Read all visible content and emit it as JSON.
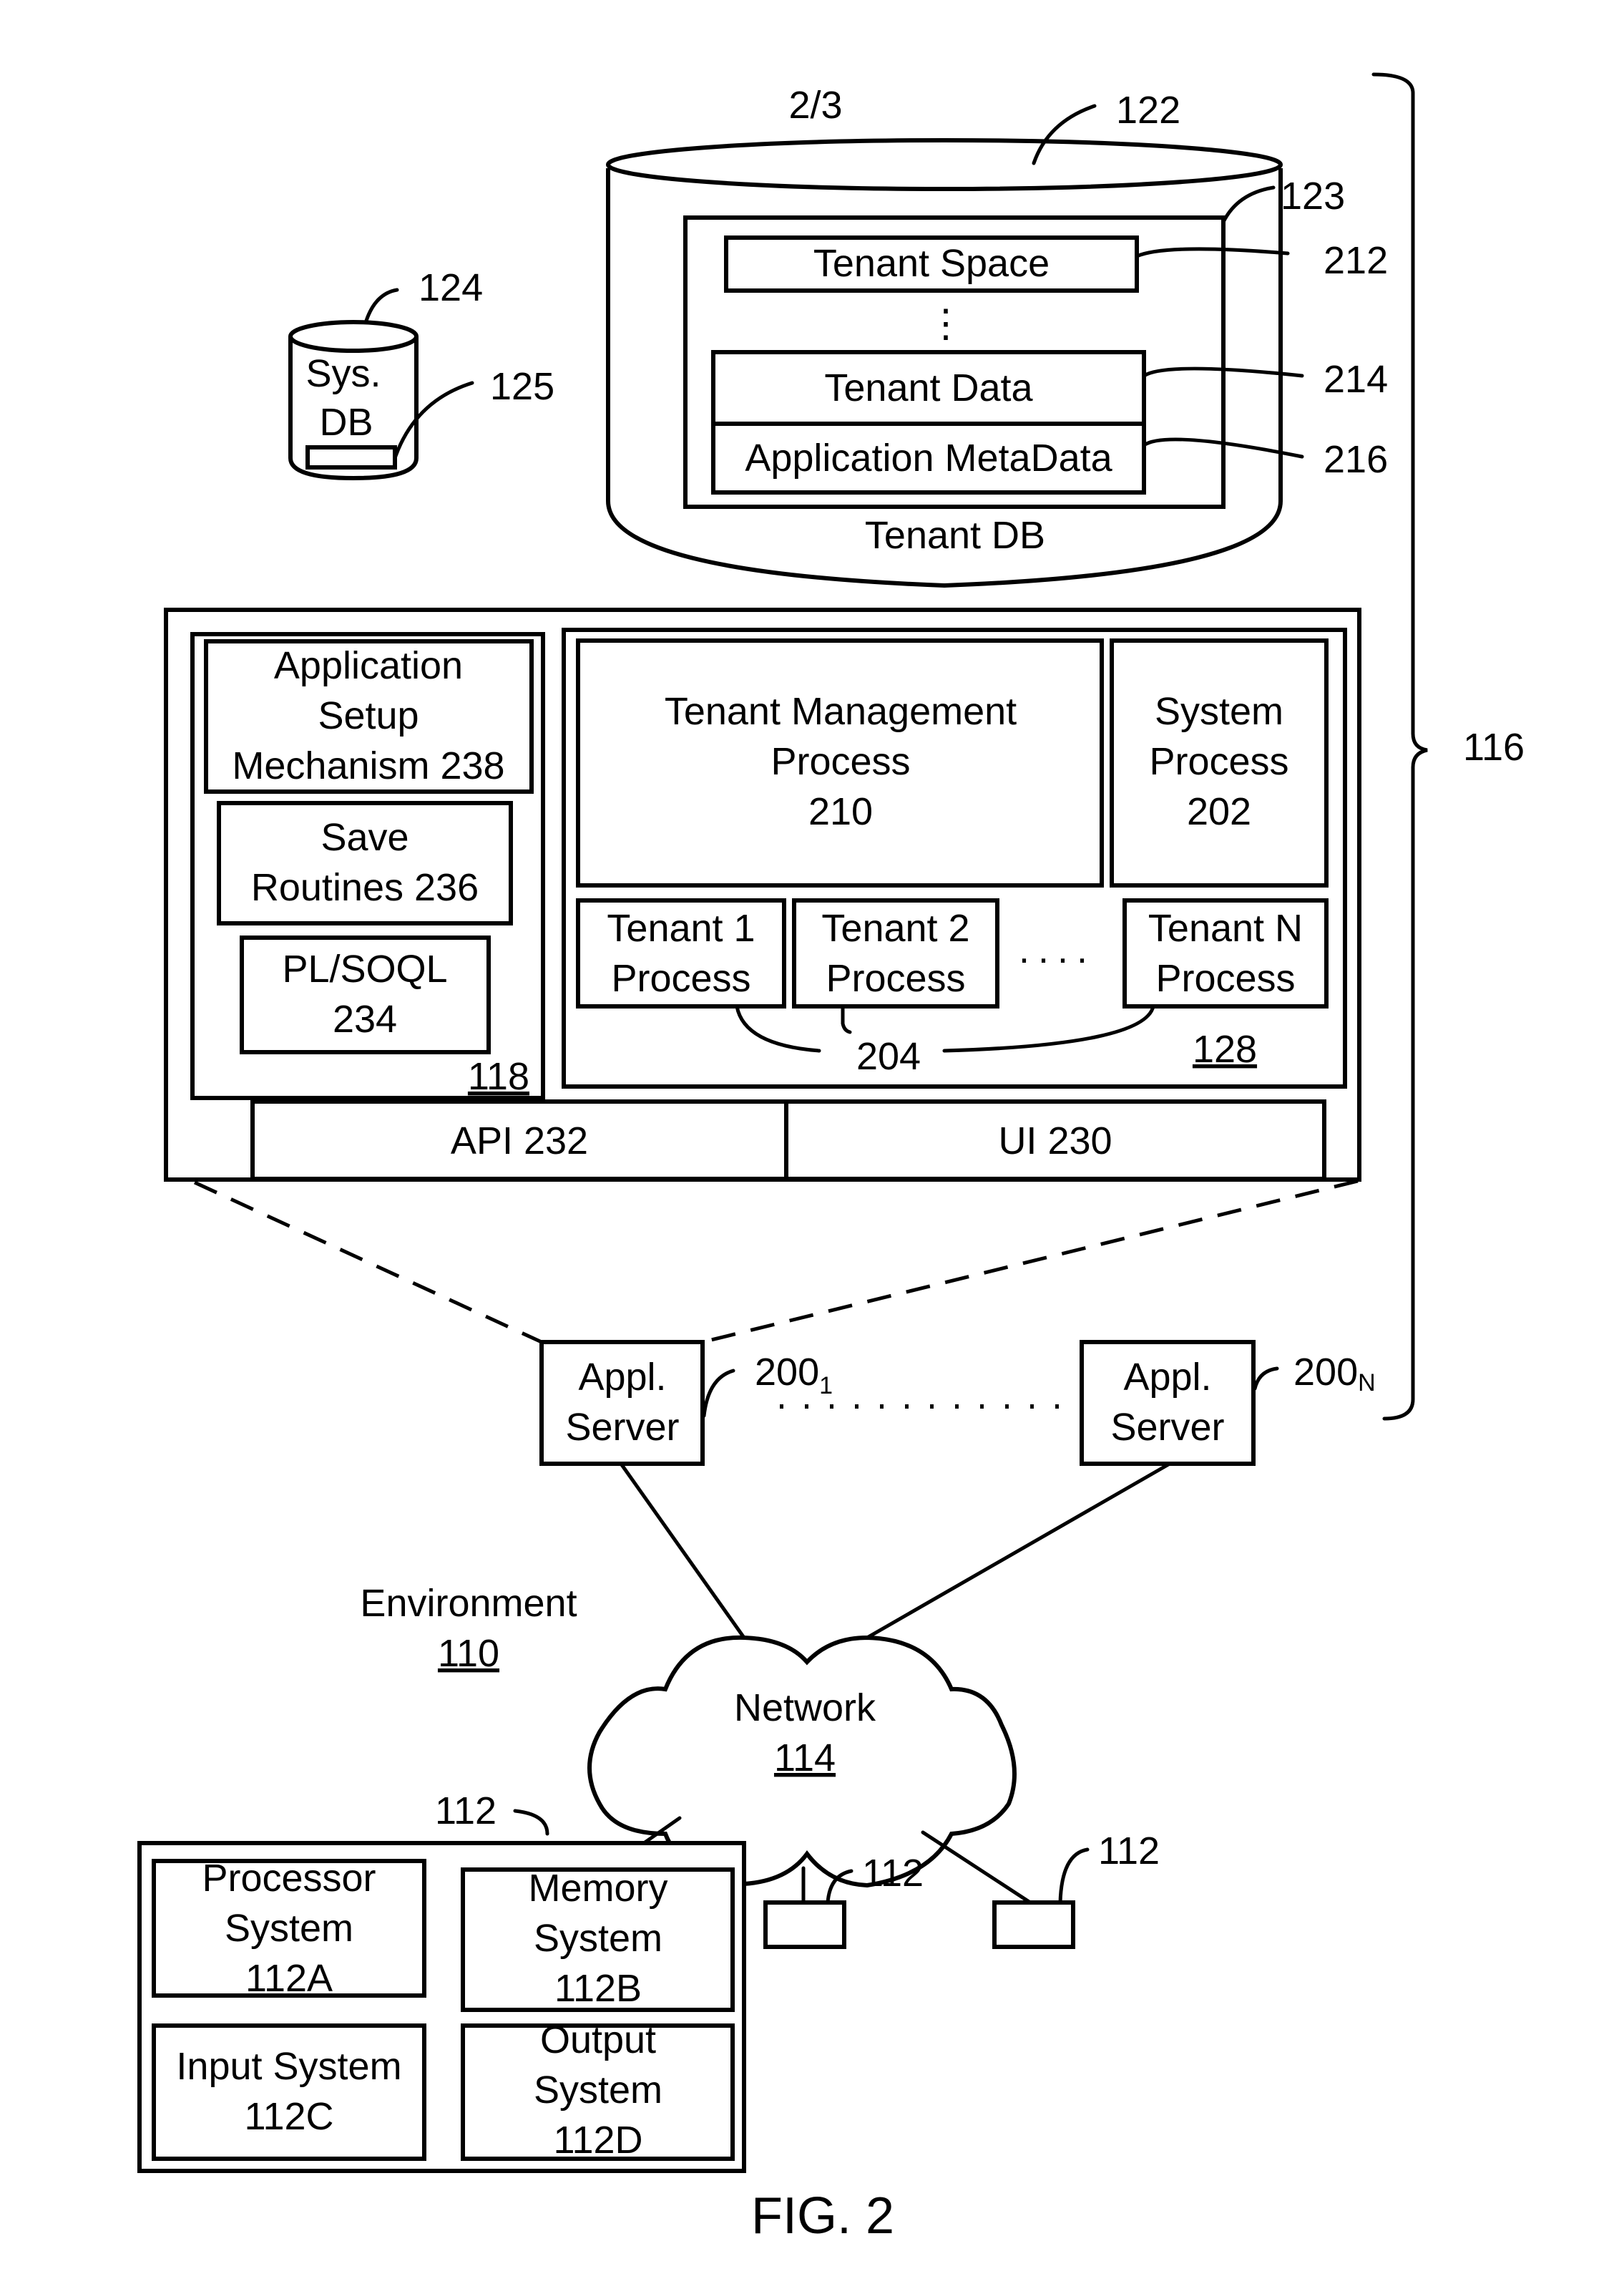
{
  "figure": {
    "caption": "FIG. 2",
    "sheet": "2/3",
    "environment": {
      "label": "Environment",
      "ref": "110"
    },
    "system_ref": "116"
  },
  "tenant_db": {
    "ref": "122",
    "label": "Tenant DB",
    "container_ref": "123",
    "tenant_space": {
      "label": "Tenant Space",
      "ref": "212"
    },
    "ellipsis": "⋮",
    "tenant_data": {
      "label": "Tenant Data",
      "ref": "214"
    },
    "app_metadata": {
      "label": "Application MetaData",
      "ref": "216"
    }
  },
  "system_db": {
    "ref": "124",
    "line1": "Sys.",
    "line2": "DB",
    "record_ref": "125"
  },
  "app_platform": {
    "ref": "118",
    "setup": {
      "line1": "Application",
      "line2": "Setup",
      "line3": "Mechanism 238"
    },
    "save": {
      "line1": "Save",
      "line2": "Routines 236"
    },
    "plsoql": {
      "line1": "PL/SOQL",
      "line2": "234"
    }
  },
  "process_space": {
    "ref": "128",
    "tenant_mgmt": {
      "line1": "Tenant Management",
      "line2": "Process",
      "line3": "210"
    },
    "system_process": {
      "line1": "System",
      "line2": "Process",
      "line3": "202"
    },
    "tenant_processes": [
      {
        "line1": "Tenant 1",
        "line2": "Process"
      },
      {
        "line1": "Tenant 2",
        "line2": "Process"
      },
      {
        "line1": "Tenant N",
        "line2": "Process"
      }
    ],
    "ellipsis": "....",
    "tenant_process_ref": "204"
  },
  "interfaces": {
    "api": "API 232",
    "ui": "UI 230"
  },
  "app_servers": [
    {
      "line1": "Appl.",
      "line2": "Server",
      "ref": "200",
      "sub": "1"
    },
    {
      "line1": "Appl.",
      "line2": "Server",
      "ref": "200",
      "sub": "N"
    }
  ],
  "network": {
    "label": "Network",
    "ref": "114"
  },
  "user_system": {
    "ref": "112",
    "processor": {
      "line1": "Processor",
      "line2": "System",
      "line3": "112A"
    },
    "memory": {
      "line1": "Memory",
      "line2": "System",
      "line3": "112B"
    },
    "input": {
      "line1": "Input System",
      "line2": "112C"
    },
    "output": {
      "line1": "Output",
      "line2": "System",
      "line3": "112D"
    }
  },
  "other_user_systems": [
    {
      "ref": "112"
    },
    {
      "ref": "112"
    }
  ]
}
